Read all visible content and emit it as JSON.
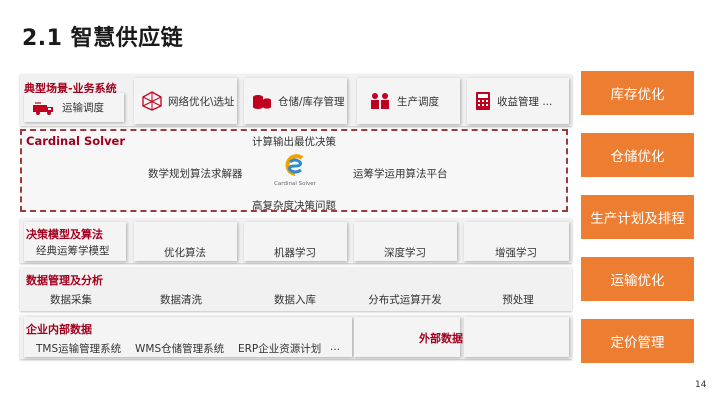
{
  "title": "2.1 智慧供应链",
  "scenes": {
    "header": "典型场景-业务系统",
    "items": [
      {
        "label": "运输调度",
        "icon": "truck-icon"
      },
      {
        "label": "网络优化\\选址",
        "icon": "network-icon"
      },
      {
        "label": "仓储/库存管理",
        "icon": "stack-icon"
      },
      {
        "label": "生产调度",
        "icon": "workers-icon"
      },
      {
        "label": "收益管理 ...",
        "icon": "calculator-icon"
      }
    ]
  },
  "solver": {
    "title": "Cardinal Solver",
    "top": "计算输出最优决策",
    "left": "数学规划算法求解器",
    "right": "运筹学运用算法平台",
    "bottom": "高复杂度决策问题",
    "logo_text": "Cardinal Solver"
  },
  "models": {
    "header": "决策模型及算法",
    "items": [
      "经典运筹学模型",
      "优化算法",
      "机器学习",
      "深度学习",
      "增强学习"
    ]
  },
  "datamgmt": {
    "header": "数据管理及分析",
    "items": [
      "数据采集",
      "数据清洗",
      "数据入库",
      "分布式运算开发",
      "预处理"
    ]
  },
  "internal": {
    "header": "企业内部数据",
    "items": [
      "TMS运输管理系统",
      "WMS仓储管理系统",
      "ERP企业资源计划",
      "..."
    ]
  },
  "external": {
    "label": "外部数据"
  },
  "right_buttons": [
    "库存优化",
    "仓储优化",
    "生产计划及排程",
    "运输优化",
    "定价管理"
  ],
  "page_number": "14",
  "colors": {
    "accent": "#ed7d31",
    "header_red": "#a3001e",
    "dashed_border": "#9b3b3b"
  }
}
